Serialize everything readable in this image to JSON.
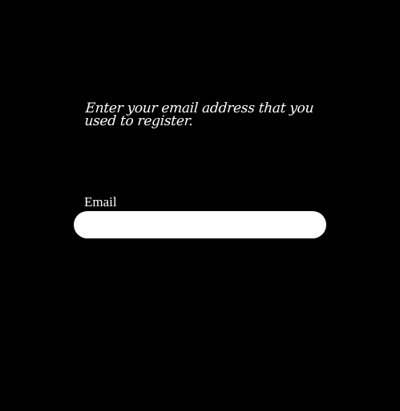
{
  "colors": {
    "background": "#000000",
    "text": "#ffffff",
    "input_background": "#ffffff"
  },
  "form": {
    "instructions": "Enter your email address that you used to register.",
    "email_label": "Email",
    "email_value": "",
    "email_placeholder": ""
  }
}
